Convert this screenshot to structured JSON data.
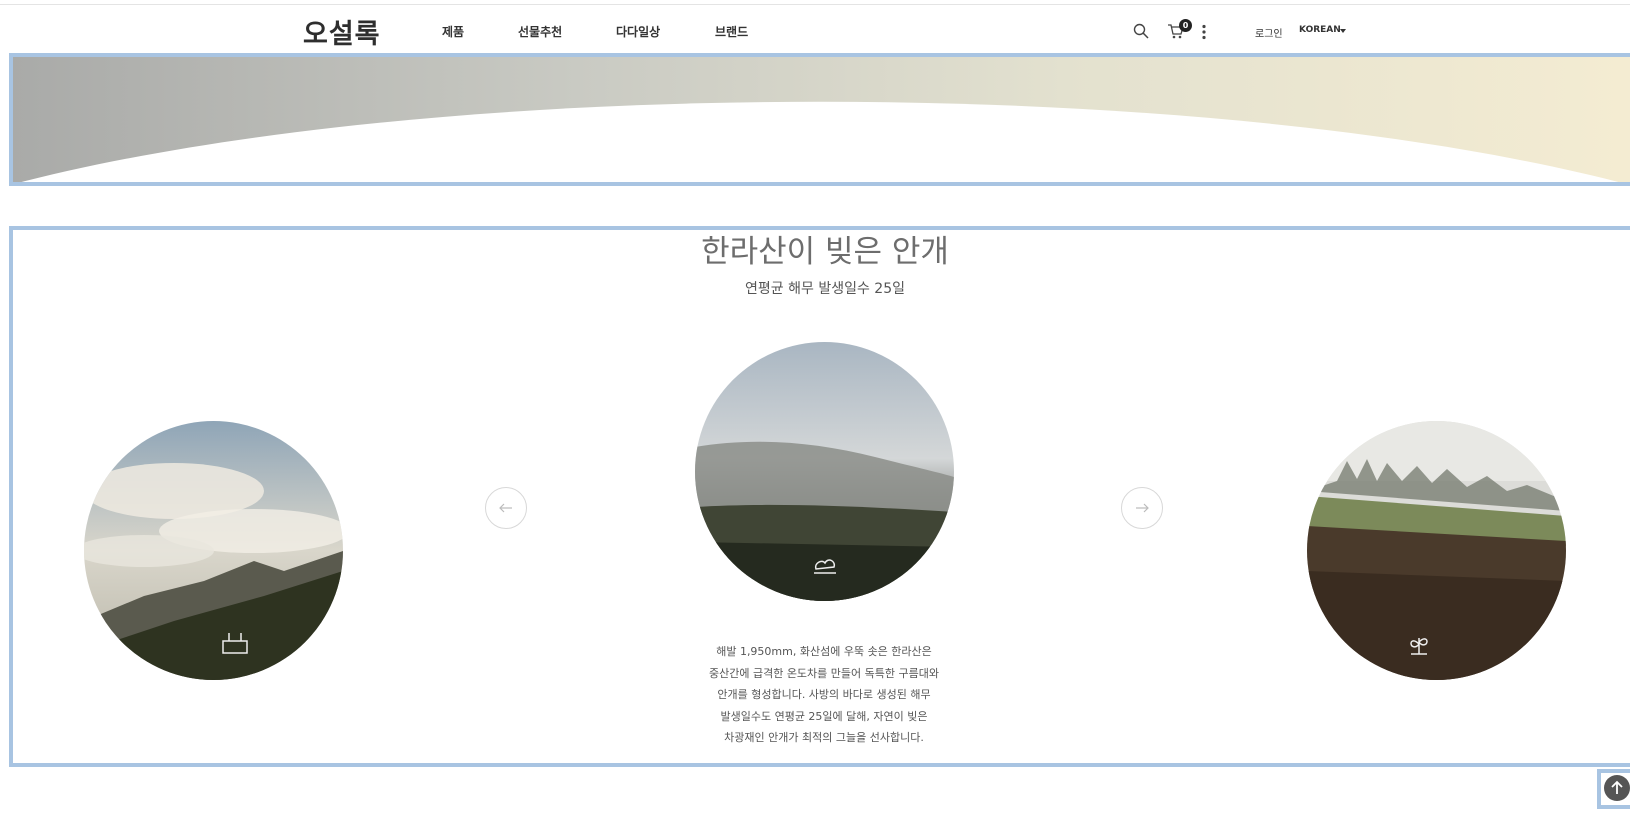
{
  "header": {
    "logo": "오설록",
    "nav": [
      "제품",
      "선물추천",
      "다다일상",
      "브랜드"
    ],
    "cart_count": "0",
    "login": "로그인",
    "language": "KOREAN",
    "icons": [
      "search-icon",
      "cart-icon",
      "more-vertical-icon"
    ]
  },
  "section": {
    "title": "한라산이 빚은 안개",
    "subtitle": "연평균 해무 발생일수 25일",
    "description_lines": [
      "해발 1,950mm, 화산섬에 우뚝 솟은 한라산은",
      "중산간에 급격한 온도차를 만들어 독특한 구름대와",
      "안개를 형성합니다. 사방의 바다로 생성된 해무",
      "발생일수도 연평균 25일에 달해, 자연이 빚은",
      "차광재인 안개가 최적의 그늘을 선사합니다."
    ],
    "images": [
      {
        "icon": "tea-box-icon"
      },
      {
        "icon": "fog-cloud-icon"
      },
      {
        "icon": "sprout-icon"
      }
    ],
    "prev_icon": "arrow-left-icon",
    "next_icon": "arrow-right-icon"
  },
  "floating": {
    "scroll_top_icon": "arrow-up-icon"
  },
  "colors": {
    "highlight": "#a8c4e2",
    "text": "#333333",
    "title": "#6d6d6d"
  }
}
